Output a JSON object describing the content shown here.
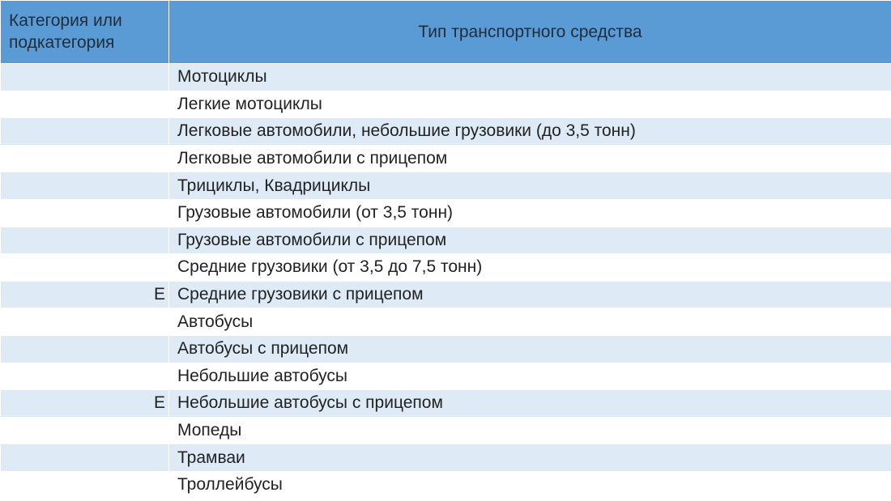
{
  "table": {
    "headers": {
      "category": "Категория или подкатегория",
      "type": "Тип транспортного средства"
    },
    "rows": [
      {
        "category": "",
        "type": "Мотоциклы"
      },
      {
        "category": "",
        "type": "Легкие мотоциклы"
      },
      {
        "category": "",
        "type": "Легковые автомобили, небольшие грузовики (до 3,5 тонн)"
      },
      {
        "category": "",
        "type": "Легковые автомобили с прицепом"
      },
      {
        "category": "",
        "type": "Трициклы, Квадрициклы"
      },
      {
        "category": "",
        "type": "Грузовые автомобили (от 3,5 тонн)"
      },
      {
        "category": "",
        "type": "Грузовые автомобили с прицепом"
      },
      {
        "category": "",
        "type": "Средние грузовики (от 3,5 до 7,5 тонн)"
      },
      {
        "category": "E",
        "type": "Средние грузовики с прицепом"
      },
      {
        "category": "",
        "type": "Автобусы"
      },
      {
        "category": "",
        "type": "Автобусы с прицепом"
      },
      {
        "category": "",
        "type": "Небольшие автобусы"
      },
      {
        "category": "E",
        "type": "Небольшие автобусы с прицепом"
      },
      {
        "category": "",
        "type": "Мопеды"
      },
      {
        "category": "",
        "type": "Трамваи"
      },
      {
        "category": "",
        "type": "Троллейбусы"
      }
    ]
  }
}
